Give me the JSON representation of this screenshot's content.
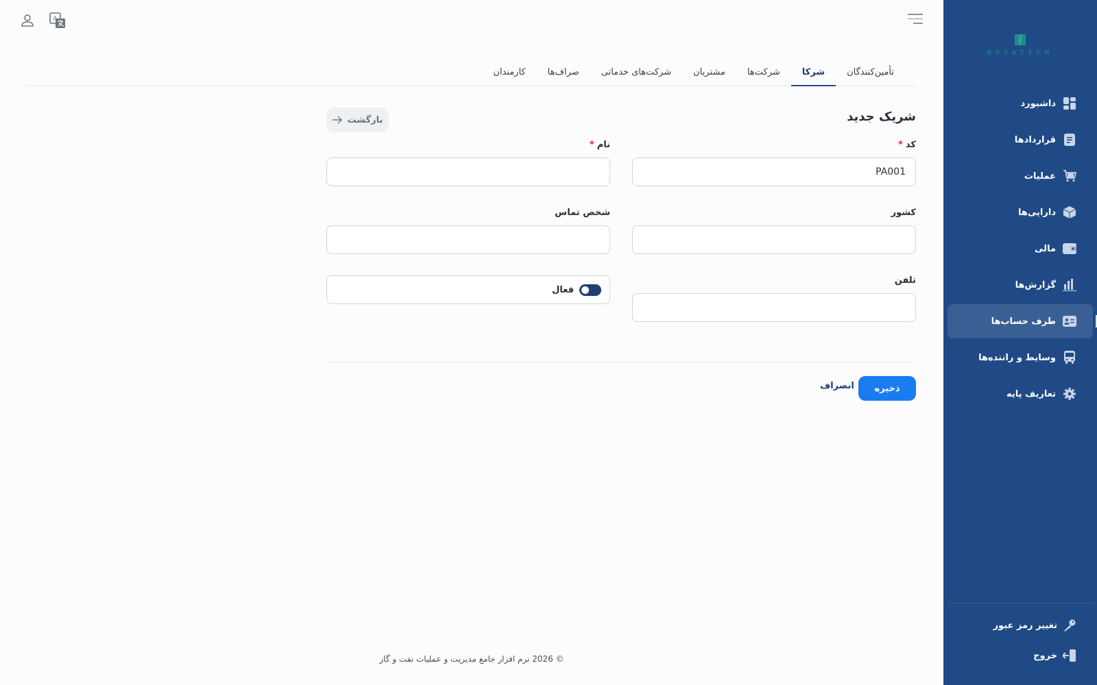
{
  "brand": {
    "logo_text": "NOVATECH"
  },
  "sidebar": {
    "items": [
      {
        "label": "داشبورد",
        "icon": "dashboard-icon",
        "active": false
      },
      {
        "label": "قراردادها",
        "icon": "document-icon",
        "active": false
      },
      {
        "label": "عملیات",
        "icon": "cart-icon",
        "active": false
      },
      {
        "label": "دارایی‌ها",
        "icon": "box-icon",
        "active": false
      },
      {
        "label": "مالی",
        "icon": "wallet-icon",
        "active": false
      },
      {
        "label": "گزارش‌ها",
        "icon": "bar-chart-icon",
        "active": false
      },
      {
        "label": "طرف حساب‌ها",
        "icon": "id-card-icon",
        "active": true
      },
      {
        "label": "وسایط و راننده‌ها",
        "icon": "bus-icon",
        "active": false
      },
      {
        "label": "تعاریف پایه",
        "icon": "gear-icon",
        "active": false
      }
    ],
    "change_password": "تغییر رمز عبور",
    "logout": "خروج"
  },
  "header": {
    "menu_icon": "hamburger-icon",
    "translate_icon": "translate-icon",
    "user_icon": "user-icon"
  },
  "tabs": [
    {
      "label": "تأمین‌کنندگان",
      "active": false
    },
    {
      "label": "شرکا",
      "active": true
    },
    {
      "label": "شرکت‌ها",
      "active": false
    },
    {
      "label": "مشتریان",
      "active": false
    },
    {
      "label": "شرکت‌های خدماتی",
      "active": false
    },
    {
      "label": "صراف‌ها",
      "active": false
    },
    {
      "label": "کارمندان",
      "active": false
    }
  ],
  "form": {
    "title": "شریک جدید",
    "back_label": "بازگشت",
    "code": {
      "label": "کد",
      "required_mark": "*",
      "value": "PA001"
    },
    "name": {
      "label": "نام",
      "required_mark": "*",
      "value": ""
    },
    "country": {
      "label": "کشور",
      "value": ""
    },
    "contact_person": {
      "label": "شخص تماس",
      "value": ""
    },
    "phone": {
      "label": "تلفن",
      "value": ""
    },
    "active_toggle": {
      "label": "فعال",
      "checked": true
    },
    "save_label": "ذخیره",
    "cancel_label": "انصراف"
  },
  "footer": {
    "text": "© 2026 نرم افزار جامع مدیریت و عملیات نفت و گاز"
  },
  "colors": {
    "sidebar_bg": "#1f4a86",
    "sidebar_active": "#3a5f94",
    "primary_button": "#1a7cf0",
    "required": "#d62828",
    "toggle_on": "#1f3f72"
  }
}
